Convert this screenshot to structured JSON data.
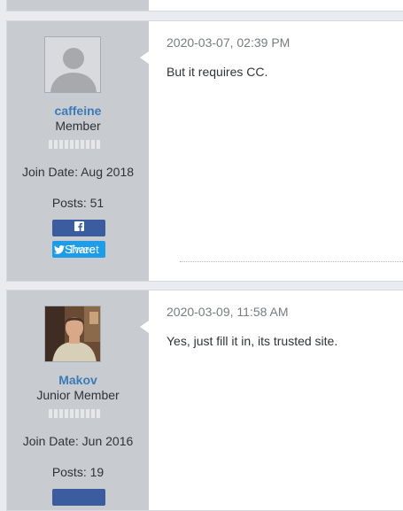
{
  "posts": [
    {
      "username": "caffeine",
      "user_title": "Member",
      "join_date": "Join Date: Aug 2018",
      "posts": "Posts: 51",
      "share_label": "Share",
      "tweet_label": "Tweet",
      "date": "2020-03-07, 02:39 PM",
      "message": "But it requires CC.",
      "avatar_icon": "default-avatar-silhouette"
    },
    {
      "username": "Makov",
      "user_title": "Junior Member",
      "join_date": "Join Date: Jun 2016",
      "posts": "Posts: 19",
      "date": "2020-03-09, 11:58 AM",
      "message": "Yes, just fill it in, its trusted site.",
      "avatar_icon": "photo-avatar"
    }
  ],
  "colors": {
    "page_bg": "#e9ebee",
    "userinfo_bg": "#c8ccd1",
    "username": "#3b7bb8",
    "facebook": "#3b5c9e",
    "twitter": "#1e9de6"
  }
}
